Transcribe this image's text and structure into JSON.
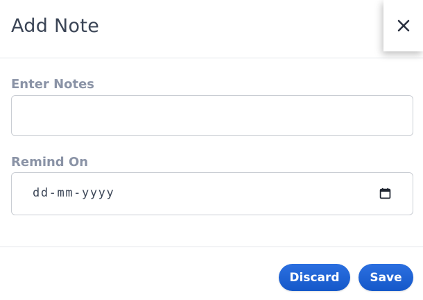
{
  "modal": {
    "title": "Add Note",
    "close_icon": "close-icon"
  },
  "form": {
    "notes_label": "Enter Notes",
    "notes_value": "",
    "remind_label": "Remind On",
    "date_placeholder": "dd-mm-yyyy",
    "calendar_icon": "calendar-icon"
  },
  "footer": {
    "discard_label": "Discard",
    "save_label": "Save"
  },
  "colors": {
    "accent": "#1f63d6",
    "label": "#8a93a6",
    "title": "#3b4556"
  }
}
